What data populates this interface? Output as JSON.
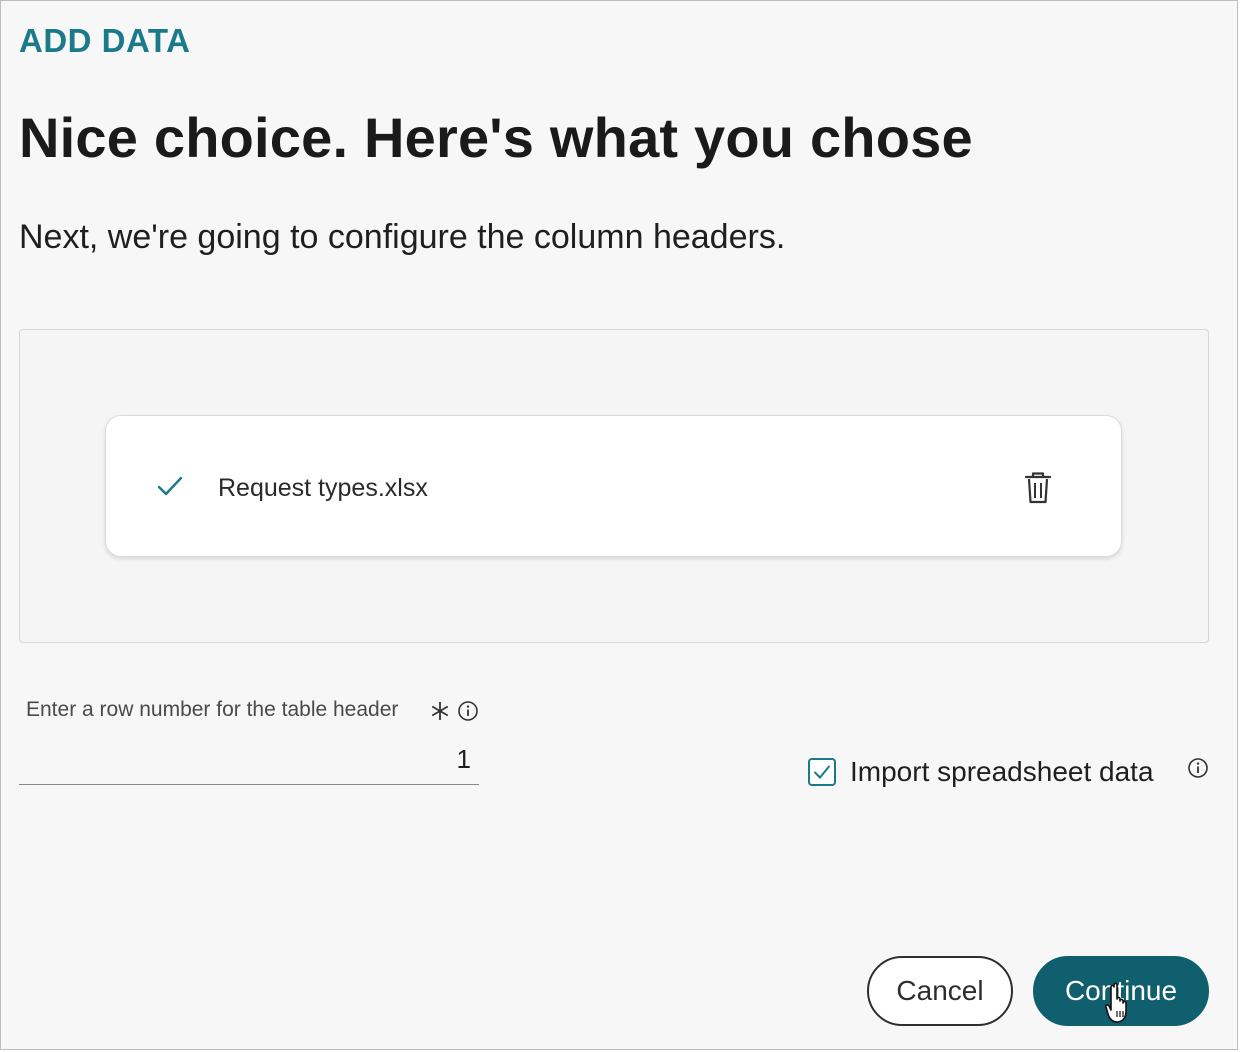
{
  "header": {
    "eyebrow": "ADD DATA",
    "title": "Nice choice. Here's what you chose",
    "subtitle": "Next, we're going to configure the column headers."
  },
  "file": {
    "name": "Request types.xlsx",
    "status_icon": "check-icon",
    "delete_icon": "trash-icon"
  },
  "header_row_field": {
    "label": "Enter a row number for the table header",
    "required_marker": "asterisk-icon",
    "info_icon": "info-icon",
    "value": "1"
  },
  "import_option": {
    "label": "Import spreadsheet data",
    "checked": true,
    "info_icon": "info-icon"
  },
  "actions": {
    "cancel_label": "Cancel",
    "continue_label": "Continue"
  },
  "colors": {
    "accent": "#1b7a8a",
    "primary_button": "#0f5f6e",
    "background": "#f7f7f7"
  }
}
